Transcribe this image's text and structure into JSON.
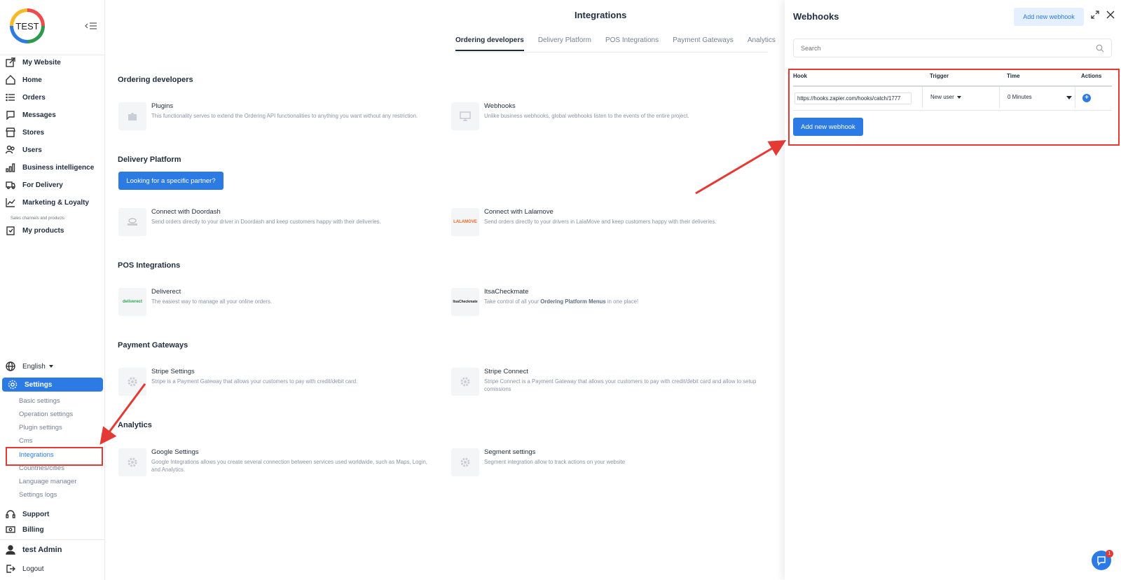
{
  "logo_text": "TEST",
  "sidebar": {
    "items": [
      {
        "label": "My Website",
        "icon": "external-link-icon"
      },
      {
        "label": "Home",
        "icon": "home-icon"
      },
      {
        "label": "Orders",
        "icon": "list-icon"
      },
      {
        "label": "Messages",
        "icon": "chat-icon"
      },
      {
        "label": "Stores",
        "icon": "store-icon"
      },
      {
        "label": "Users",
        "icon": "users-icon"
      },
      {
        "label": "Business intelligence",
        "icon": "bar-chart-icon"
      },
      {
        "label": "For Delivery",
        "icon": "truck-icon"
      },
      {
        "label": "Marketing & Loyalty",
        "icon": "line-chart-icon"
      }
    ],
    "sales_channels_label": "Sales channels and products",
    "my_products": "My products",
    "language": "English",
    "settings": "Settings",
    "settings_sub": [
      "Basic settings",
      "Operation settings",
      "Plugin settings",
      "Cms",
      "Integrations",
      "Countries/cities",
      "Language manager",
      "Settings logs"
    ],
    "support": "Support",
    "billing": "Billing",
    "user_name": "test Admin",
    "logout": "Logout"
  },
  "main": {
    "title": "Integrations",
    "tabs": [
      "Ordering developers",
      "Delivery Platform",
      "POS Integrations",
      "Payment Gateways",
      "Analytics"
    ],
    "active_tab": "Ordering developers",
    "sections": {
      "ordering": {
        "title": "Ordering developers",
        "plugins_title": "Plugins",
        "plugins_desc": "This functionality serves to extend the Ordering API functionalities to anything you want without any restriction.",
        "webhooks_title": "Webhooks",
        "webhooks_desc": "Unlike business webhooks, global webhooks listen to the events of the entire project."
      },
      "delivery": {
        "title": "Delivery Platform",
        "partner_button": "Looking for a specific partner?",
        "doordash_title": "Connect with Doordash",
        "doordash_desc": "Send orders directly to your driver in Doordash and keep customers happy with their deliveries.",
        "lalamove_title": "Connect with Lalamove",
        "lalamove_desc": "Send orders directly to your drivers in LalaMove and keep customers happy with their deliveries.",
        "lalamove_logo": "LALAMOVE"
      },
      "pos": {
        "title": "POS Integrations",
        "deliverect_title": "Deliverect",
        "deliverect_desc": "The easiest way to manage all your online orders.",
        "deliverect_logo": "deliverect",
        "itsa_title": "ItsaCheckmate",
        "itsa_desc_pre": "Take control of all your ",
        "itsa_desc_bold": "Ordering Platform Menus",
        "itsa_desc_post": " in one place!",
        "itsa_logo": "ItsaCheckmate"
      },
      "payment": {
        "title": "Payment Gateways",
        "stripe_title": "Stripe Settings",
        "stripe_desc": "Stripe is a Payment Gateway that allows your customers to pay with credit/debit card.",
        "connect_title": "Stripe Connect",
        "connect_desc": "Stripe Connect is a Payment Gateway that allows your customers to pay with credit/debit card and allow to setup comissions"
      },
      "analytics": {
        "title": "Analytics",
        "google_title": "Google Settings",
        "google_desc": "Google Integrations allows you create several connection between services used worldwide, such as Maps, Login, and Analytics.",
        "segment_title": "Segment settings",
        "segment_desc": "Segment integration allow to track actions on your website"
      }
    }
  },
  "panel": {
    "title": "Webhooks",
    "add_top": "Add new webhook",
    "search_placeholder": "Search",
    "headers": {
      "hook": "Hook",
      "trigger": "Trigger",
      "time": "Time",
      "actions": "Actions"
    },
    "row": {
      "hook": "https://hooks.zapier.com/hooks/catch/1777",
      "trigger": "New user",
      "time": "0 Minutes"
    },
    "add_button": "Add new webhook"
  },
  "chat_badge": "1",
  "colors": {
    "accent": "#2c7be5",
    "highlight": "#e53935"
  }
}
